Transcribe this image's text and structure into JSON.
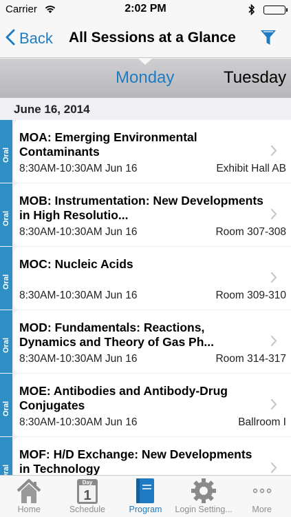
{
  "status_bar": {
    "carrier": "Carrier",
    "time": "2:02 PM"
  },
  "nav": {
    "back_label": "Back",
    "title": "All Sessions at a Glance",
    "filter_icon": "filter-icon"
  },
  "days": [
    {
      "label": "Monday",
      "selected": true
    },
    {
      "label": "Tuesday",
      "selected": false
    }
  ],
  "date_header": "June 16, 2014",
  "sessions": [
    {
      "type": "Oral",
      "title": "MOA: Emerging Environmental Contaminants",
      "time": "8:30AM-10:30AM  Jun 16",
      "room": "Exhibit Hall AB"
    },
    {
      "type": "Oral",
      "title": "MOB: Instrumentation: New Developments in High Resolutio...",
      "time": "8:30AM-10:30AM  Jun 16",
      "room": "Room 307-308"
    },
    {
      "type": "Oral",
      "title": "MOC: Nucleic Acids",
      "time": "8:30AM-10:30AM  Jun 16",
      "room": "Room 309-310"
    },
    {
      "type": "Oral",
      "title": "MOD: Fundamentals: Reactions, Dynamics and Theory of Gas Ph...",
      "time": "8:30AM-10:30AM  Jun 16",
      "room": "Room 314-317"
    },
    {
      "type": "Oral",
      "title": "MOE: Antibodies and Antibody-Drug Conjugates",
      "time": "8:30AM-10:30AM  Jun 16",
      "room": "Ballroom I"
    },
    {
      "type": "Oral",
      "title": "MOF: H/D Exchange: New Developments in Technology",
      "time": "",
      "room": ""
    }
  ],
  "tab_bar": [
    {
      "label": "Home",
      "icon": "home-icon",
      "active": false
    },
    {
      "label": "Schedule",
      "icon": "calendar-icon",
      "icon_text": "Day",
      "icon_num": "1",
      "active": false
    },
    {
      "label": "Program",
      "icon": "book-icon",
      "active": true
    },
    {
      "label": "Login Setting...",
      "icon": "gear-icon",
      "active": false
    },
    {
      "label": "More",
      "icon": "more-icon",
      "active": false
    }
  ],
  "colors": {
    "accent": "#1f7bc1",
    "oral_tab": "#2f8fc5",
    "inactive_tab": "#8e8e93"
  }
}
